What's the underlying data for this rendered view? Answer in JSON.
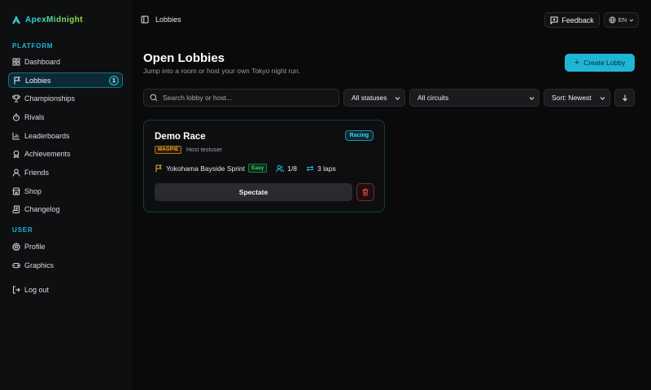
{
  "brand": {
    "name": "ApexMidnight"
  },
  "sidebar": {
    "platform_label": "PLATFORM",
    "user_label": "USER",
    "items": [
      {
        "label": "Dashboard",
        "icon": "grid-icon"
      },
      {
        "label": "Lobbies",
        "icon": "flag-icon",
        "count": "1",
        "active": true
      },
      {
        "label": "Championships",
        "icon": "trophy-icon"
      },
      {
        "label": "Rivals",
        "icon": "timer-icon"
      },
      {
        "label": "Leaderboards",
        "icon": "bar-chart-icon"
      },
      {
        "label": "Achievements",
        "icon": "medal-icon"
      },
      {
        "label": "Friends",
        "icon": "user-icon"
      },
      {
        "label": "Shop",
        "icon": "store-icon"
      },
      {
        "label": "Changelog",
        "icon": "scroll-icon"
      }
    ],
    "user_items": [
      {
        "label": "Profile",
        "icon": "gear-icon"
      },
      {
        "label": "Graphics",
        "icon": "gamepad-icon"
      }
    ],
    "logout": {
      "label": "Log out",
      "icon": "logout-icon"
    }
  },
  "topbar": {
    "breadcrumb": "Lobbies",
    "feedback_label": "Feedback",
    "language": "EN"
  },
  "main": {
    "title": "Open Lobbies",
    "subtitle": "Jump into a room or host your own Tokyo night run.",
    "create_label": "Create Lobby",
    "search_placeholder": "Search lobby or host...",
    "status_filter": "All statuses",
    "circuit_filter": "All circuits",
    "sort": "Sort: Newest"
  },
  "lobbies": [
    {
      "name": "Demo Race",
      "status": "Racing",
      "car": "MAGPIE",
      "host": "Host testuser",
      "circuit": "Yokohama Bayside Sprint",
      "difficulty": "Easy",
      "players": "1/8",
      "laps": "3 laps",
      "action_label": "Spectate"
    }
  ],
  "colors": {
    "accent": "#1fb6d6",
    "background": "#0a0a0b",
    "status_racing": "#48d2ee",
    "car_tag": "#f0b13a",
    "difficulty_easy": "#3fd27a",
    "danger": "#e0464f"
  }
}
